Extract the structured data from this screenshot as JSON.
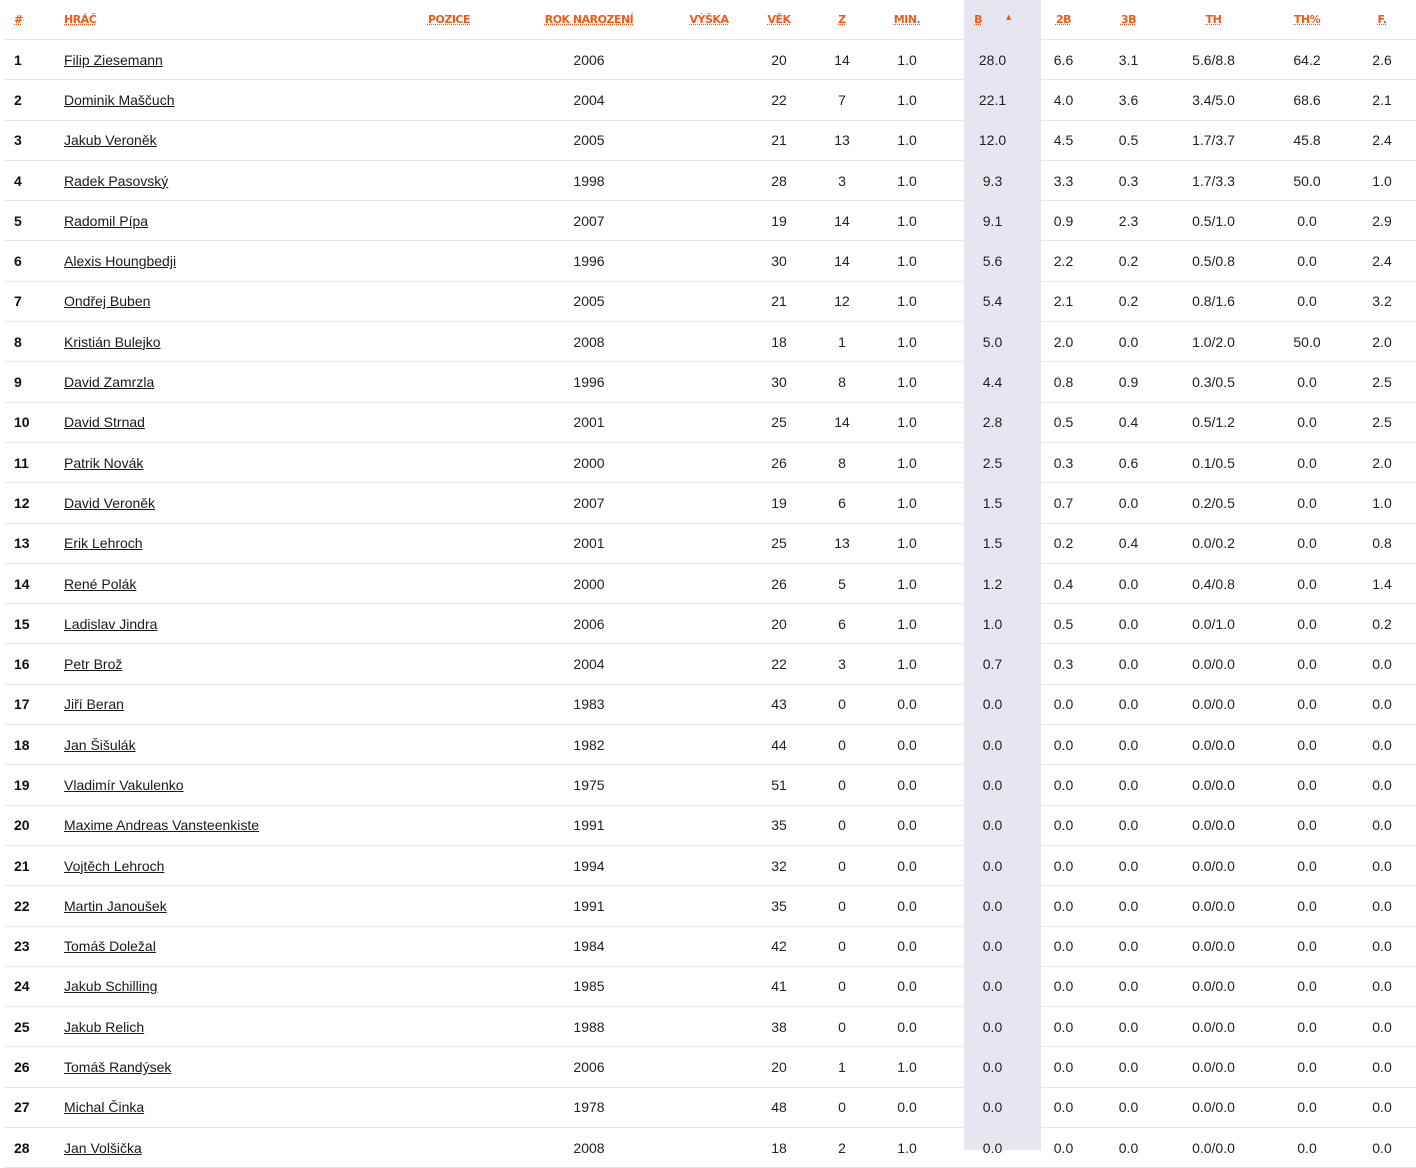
{
  "headers": {
    "rank": "#",
    "player": "HRÁČ",
    "position": "POZICE",
    "birth_year": "ROK NAROZENÍ",
    "height": "VÝŠKA",
    "age": "VĚK",
    "games": "Z",
    "minutes": "MIN.",
    "points": "B",
    "two_pt": "2B",
    "three_pt": "3B",
    "free_throws": "TH",
    "ft_percent": "TH%",
    "fouls": "F."
  },
  "sorted_column": "points",
  "sort_indicator": "▲",
  "colors": {
    "header_accent": "#f05a14",
    "sorted_column_bg": "#e6e6f0",
    "row_divider": "#e8e8e8"
  },
  "rows": [
    {
      "rank": "1",
      "name": "Filip Ziesemann",
      "position": "",
      "birth_year": "2006",
      "height": "",
      "age": "20",
      "games": "14",
      "minutes": "1.0",
      "points": "28.0",
      "two_pt": "6.6",
      "three_pt": "3.1",
      "ft": "5.6/8.8",
      "ft_pct": "64.2",
      "fouls": "2.6"
    },
    {
      "rank": "2",
      "name": "Dominik Maščuch",
      "position": "",
      "birth_year": "2004",
      "height": "",
      "age": "22",
      "games": "7",
      "minutes": "1.0",
      "points": "22.1",
      "two_pt": "4.0",
      "three_pt": "3.6",
      "ft": "3.4/5.0",
      "ft_pct": "68.6",
      "fouls": "2.1"
    },
    {
      "rank": "3",
      "name": "Jakub Veroněk",
      "position": "",
      "birth_year": "2005",
      "height": "",
      "age": "21",
      "games": "13",
      "minutes": "1.0",
      "points": "12.0",
      "two_pt": "4.5",
      "three_pt": "0.5",
      "ft": "1.7/3.7",
      "ft_pct": "45.8",
      "fouls": "2.4"
    },
    {
      "rank": "4",
      "name": "Radek Pasovský",
      "position": "",
      "birth_year": "1998",
      "height": "",
      "age": "28",
      "games": "3",
      "minutes": "1.0",
      "points": "9.3",
      "two_pt": "3.3",
      "three_pt": "0.3",
      "ft": "1.7/3.3",
      "ft_pct": "50.0",
      "fouls": "1.0"
    },
    {
      "rank": "5",
      "name": "Radomil Pípa",
      "position": "",
      "birth_year": "2007",
      "height": "",
      "age": "19",
      "games": "14",
      "minutes": "1.0",
      "points": "9.1",
      "two_pt": "0.9",
      "three_pt": "2.3",
      "ft": "0.5/1.0",
      "ft_pct": "0.0",
      "fouls": "2.9"
    },
    {
      "rank": "6",
      "name": "Alexis Houngbedji",
      "position": "",
      "birth_year": "1996",
      "height": "",
      "age": "30",
      "games": "14",
      "minutes": "1.0",
      "points": "5.6",
      "two_pt": "2.2",
      "three_pt": "0.2",
      "ft": "0.5/0.8",
      "ft_pct": "0.0",
      "fouls": "2.4"
    },
    {
      "rank": "7",
      "name": "Ondřej Buben",
      "position": "",
      "birth_year": "2005",
      "height": "",
      "age": "21",
      "games": "12",
      "minutes": "1.0",
      "points": "5.4",
      "two_pt": "2.1",
      "three_pt": "0.2",
      "ft": "0.8/1.6",
      "ft_pct": "0.0",
      "fouls": "3.2"
    },
    {
      "rank": "8",
      "name": "Kristián Bulejko",
      "position": "",
      "birth_year": "2008",
      "height": "",
      "age": "18",
      "games": "1",
      "minutes": "1.0",
      "points": "5.0",
      "two_pt": "2.0",
      "three_pt": "0.0",
      "ft": "1.0/2.0",
      "ft_pct": "50.0",
      "fouls": "2.0"
    },
    {
      "rank": "9",
      "name": "David Zamrzla",
      "position": "",
      "birth_year": "1996",
      "height": "",
      "age": "30",
      "games": "8",
      "minutes": "1.0",
      "points": "4.4",
      "two_pt": "0.8",
      "three_pt": "0.9",
      "ft": "0.3/0.5",
      "ft_pct": "0.0",
      "fouls": "2.5"
    },
    {
      "rank": "10",
      "name": "David Strnad",
      "position": "",
      "birth_year": "2001",
      "height": "",
      "age": "25",
      "games": "14",
      "minutes": "1.0",
      "points": "2.8",
      "two_pt": "0.5",
      "three_pt": "0.4",
      "ft": "0.5/1.2",
      "ft_pct": "0.0",
      "fouls": "2.5"
    },
    {
      "rank": "11",
      "name": "Patrik Novák",
      "position": "",
      "birth_year": "2000",
      "height": "",
      "age": "26",
      "games": "8",
      "minutes": "1.0",
      "points": "2.5",
      "two_pt": "0.3",
      "three_pt": "0.6",
      "ft": "0.1/0.5",
      "ft_pct": "0.0",
      "fouls": "2.0"
    },
    {
      "rank": "12",
      "name": "David Veroněk",
      "position": "",
      "birth_year": "2007",
      "height": "",
      "age": "19",
      "games": "6",
      "minutes": "1.0",
      "points": "1.5",
      "two_pt": "0.7",
      "three_pt": "0.0",
      "ft": "0.2/0.5",
      "ft_pct": "0.0",
      "fouls": "1.0"
    },
    {
      "rank": "13",
      "name": "Erik Lehroch",
      "position": "",
      "birth_year": "2001",
      "height": "",
      "age": "25",
      "games": "13",
      "minutes": "1.0",
      "points": "1.5",
      "two_pt": "0.2",
      "three_pt": "0.4",
      "ft": "0.0/0.2",
      "ft_pct": "0.0",
      "fouls": "0.8"
    },
    {
      "rank": "14",
      "name": "René Polák",
      "position": "",
      "birth_year": "2000",
      "height": "",
      "age": "26",
      "games": "5",
      "minutes": "1.0",
      "points": "1.2",
      "two_pt": "0.4",
      "three_pt": "0.0",
      "ft": "0.4/0.8",
      "ft_pct": "0.0",
      "fouls": "1.4"
    },
    {
      "rank": "15",
      "name": "Ladislav Jindra",
      "position": "",
      "birth_year": "2006",
      "height": "",
      "age": "20",
      "games": "6",
      "minutes": "1.0",
      "points": "1.0",
      "two_pt": "0.5",
      "three_pt": "0.0",
      "ft": "0.0/1.0",
      "ft_pct": "0.0",
      "fouls": "0.2"
    },
    {
      "rank": "16",
      "name": "Petr Brož",
      "position": "",
      "birth_year": "2004",
      "height": "",
      "age": "22",
      "games": "3",
      "minutes": "1.0",
      "points": "0.7",
      "two_pt": "0.3",
      "three_pt": "0.0",
      "ft": "0.0/0.0",
      "ft_pct": "0.0",
      "fouls": "0.0"
    },
    {
      "rank": "17",
      "name": "Jiří Beran",
      "position": "",
      "birth_year": "1983",
      "height": "",
      "age": "43",
      "games": "0",
      "minutes": "0.0",
      "points": "0.0",
      "two_pt": "0.0",
      "three_pt": "0.0",
      "ft": "0.0/0.0",
      "ft_pct": "0.0",
      "fouls": "0.0"
    },
    {
      "rank": "18",
      "name": "Jan Šišulák",
      "position": "",
      "birth_year": "1982",
      "height": "",
      "age": "44",
      "games": "0",
      "minutes": "0.0",
      "points": "0.0",
      "two_pt": "0.0",
      "three_pt": "0.0",
      "ft": "0.0/0.0",
      "ft_pct": "0.0",
      "fouls": "0.0"
    },
    {
      "rank": "19",
      "name": "Vladimír Vakulenko",
      "position": "",
      "birth_year": "1975",
      "height": "",
      "age": "51",
      "games": "0",
      "minutes": "0.0",
      "points": "0.0",
      "two_pt": "0.0",
      "three_pt": "0.0",
      "ft": "0.0/0.0",
      "ft_pct": "0.0",
      "fouls": "0.0"
    },
    {
      "rank": "20",
      "name": "Maxime Andreas Vansteenkiste",
      "position": "",
      "birth_year": "1991",
      "height": "",
      "age": "35",
      "games": "0",
      "minutes": "0.0",
      "points": "0.0",
      "two_pt": "0.0",
      "three_pt": "0.0",
      "ft": "0.0/0.0",
      "ft_pct": "0.0",
      "fouls": "0.0"
    },
    {
      "rank": "21",
      "name": "Vojtěch Lehroch",
      "position": "",
      "birth_year": "1994",
      "height": "",
      "age": "32",
      "games": "0",
      "minutes": "0.0",
      "points": "0.0",
      "two_pt": "0.0",
      "three_pt": "0.0",
      "ft": "0.0/0.0",
      "ft_pct": "0.0",
      "fouls": "0.0"
    },
    {
      "rank": "22",
      "name": "Martin Janoušek",
      "position": "",
      "birth_year": "1991",
      "height": "",
      "age": "35",
      "games": "0",
      "minutes": "0.0",
      "points": "0.0",
      "two_pt": "0.0",
      "three_pt": "0.0",
      "ft": "0.0/0.0",
      "ft_pct": "0.0",
      "fouls": "0.0"
    },
    {
      "rank": "23",
      "name": "Tomáš Doležal",
      "position": "",
      "birth_year": "1984",
      "height": "",
      "age": "42",
      "games": "0",
      "minutes": "0.0",
      "points": "0.0",
      "two_pt": "0.0",
      "three_pt": "0.0",
      "ft": "0.0/0.0",
      "ft_pct": "0.0",
      "fouls": "0.0"
    },
    {
      "rank": "24",
      "name": "Jakub Schilling",
      "position": "",
      "birth_year": "1985",
      "height": "",
      "age": "41",
      "games": "0",
      "minutes": "0.0",
      "points": "0.0",
      "two_pt": "0.0",
      "three_pt": "0.0",
      "ft": "0.0/0.0",
      "ft_pct": "0.0",
      "fouls": "0.0"
    },
    {
      "rank": "25",
      "name": "Jakub Relich",
      "position": "",
      "birth_year": "1988",
      "height": "",
      "age": "38",
      "games": "0",
      "minutes": "0.0",
      "points": "0.0",
      "two_pt": "0.0",
      "three_pt": "0.0",
      "ft": "0.0/0.0",
      "ft_pct": "0.0",
      "fouls": "0.0"
    },
    {
      "rank": "26",
      "name": "Tomáš Randýsek",
      "position": "",
      "birth_year": "2006",
      "height": "",
      "age": "20",
      "games": "1",
      "minutes": "1.0",
      "points": "0.0",
      "two_pt": "0.0",
      "three_pt": "0.0",
      "ft": "0.0/0.0",
      "ft_pct": "0.0",
      "fouls": "0.0"
    },
    {
      "rank": "27",
      "name": "Michal Činka",
      "position": "",
      "birth_year": "1978",
      "height": "",
      "age": "48",
      "games": "0",
      "minutes": "0.0",
      "points": "0.0",
      "two_pt": "0.0",
      "three_pt": "0.0",
      "ft": "0.0/0.0",
      "ft_pct": "0.0",
      "fouls": "0.0"
    },
    {
      "rank": "28",
      "name": "Jan Volšička",
      "position": "",
      "birth_year": "2008",
      "height": "",
      "age": "18",
      "games": "2",
      "minutes": "1.0",
      "points": "0.0",
      "two_pt": "0.0",
      "three_pt": "0.0",
      "ft": "0.0/0.0",
      "ft_pct": "0.0",
      "fouls": "0.0"
    }
  ]
}
